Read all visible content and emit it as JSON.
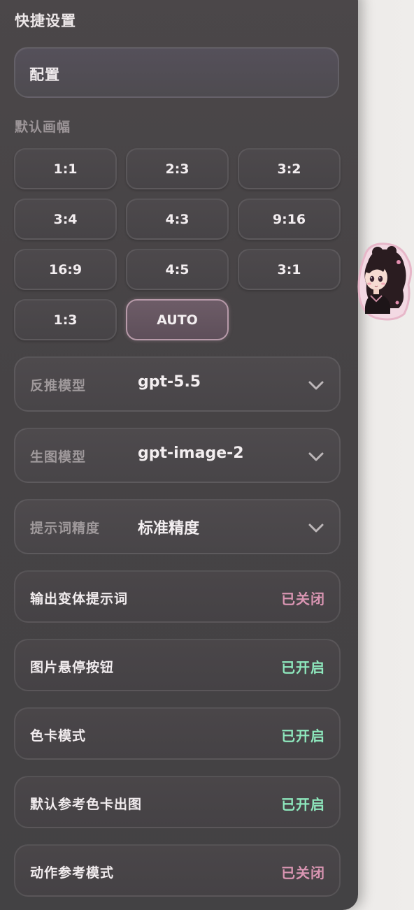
{
  "panel": {
    "title": "快捷设置",
    "config_label": "配置"
  },
  "aspect": {
    "label": "默认画幅",
    "options": [
      "1:1",
      "2:3",
      "3:2",
      "3:4",
      "4:3",
      "9:16",
      "16:9",
      "4:5",
      "3:1",
      "1:3",
      "AUTO"
    ],
    "selected": "AUTO"
  },
  "selects": [
    {
      "label": "反推模型",
      "value": "gpt-5.5"
    },
    {
      "label": "生图模型",
      "value": "gpt-image-2"
    },
    {
      "label": "提示词精度",
      "value": "标准精度"
    }
  ],
  "toggles": [
    {
      "label": "输出变体提示词",
      "status": "已关闭",
      "on": false
    },
    {
      "label": "图片悬停按钮",
      "status": "已开启",
      "on": true
    },
    {
      "label": "色卡模式",
      "status": "已开启",
      "on": true
    },
    {
      "label": "默认参考色卡出图",
      "status": "已开启",
      "on": true
    },
    {
      "label": "动作参考模式",
      "status": "已关闭",
      "on": false
    }
  ],
  "colors": {
    "on": "#8ee8bd",
    "off": "#d995b2",
    "active_ratio_border": "#b79aa9"
  },
  "icons": {
    "dropdown": "chevron-down-icon",
    "mascot": "anime-girl-sticker"
  }
}
